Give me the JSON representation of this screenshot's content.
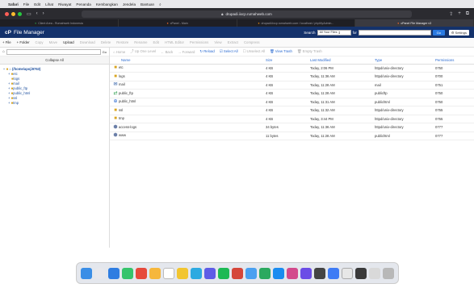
{
  "menubar": {
    "app": "Safari",
    "items": [
      "File",
      "Edit",
      "Lihat",
      "Riwayat",
      "Penanda",
      "Kembangkan",
      "Jendela",
      "Bantuan"
    ],
    "clock": "Kam 16 Jun 15.41"
  },
  "browser": {
    "url": "drupadi.iixcp.rumahweb.com",
    "tabs": [
      {
        "label": "Client Area - Rumahweb Indonesia",
        "active": false
      },
      {
        "label": "cPanel - Main",
        "active": false
      },
      {
        "label": "drupadi.iixcp.rumahweb.com / localhost / phpMyAdmin...",
        "active": false
      },
      {
        "label": "cPanel File Manager v3",
        "active": true
      }
    ]
  },
  "header": {
    "title": "File Manager",
    "search_label": "Search",
    "search_scope": "All Your Files",
    "for_label": "for",
    "go": "Go",
    "settings": "Settings"
  },
  "actions": [
    {
      "label": "+ File",
      "enabled": true
    },
    {
      "label": "+ Folder",
      "enabled": true
    },
    {
      "label": "Copy",
      "enabled": false
    },
    {
      "label": "Move",
      "enabled": false
    },
    {
      "label": "Upload",
      "enabled": true
    },
    {
      "label": "Download",
      "enabled": false
    },
    {
      "label": "Delete",
      "enabled": false
    },
    {
      "label": "Restore",
      "enabled": false
    },
    {
      "label": "Rename",
      "enabled": false
    },
    {
      "label": "Edit",
      "enabled": false
    },
    {
      "label": "HTML Editor",
      "enabled": false
    },
    {
      "label": "Permissions",
      "enabled": false
    },
    {
      "label": "View",
      "enabled": false
    },
    {
      "label": "Extract",
      "enabled": false
    },
    {
      "label": "Compress",
      "enabled": false
    }
  ],
  "sidebar": {
    "go": "Go",
    "collapse": "Collapse All",
    "root": "(/home/apoji9763)",
    "tree": [
      "etc",
      "logs",
      "mail",
      "public_ftp",
      "public_html",
      "ssl",
      "tmp"
    ]
  },
  "nav": {
    "home": "Home",
    "up": "Up One Level",
    "back": "Back",
    "forward": "Forward",
    "reload": "Reload",
    "select_all": "Select All",
    "unselect_all": "Unselect All",
    "view_trash": "View Trash",
    "empty_trash": "Empty Trash"
  },
  "columns": [
    "Name",
    "Size",
    "Last Modified",
    "Type",
    "Permissions"
  ],
  "files": [
    {
      "icon": "folder-icon",
      "name": "etc",
      "size": "4 KB",
      "modified": "Today, 2:06 PM",
      "type": "httpd/unix-directory",
      "perm": "0750"
    },
    {
      "icon": "folder-icon",
      "name": "logs",
      "size": "4 KB",
      "modified": "Today, 11:36 AM",
      "type": "httpd/unix-directory",
      "perm": "0700"
    },
    {
      "icon": "mail-icon",
      "name": "mail",
      "size": "4 KB",
      "modified": "Today, 11:28 AM",
      "type": "mail",
      "perm": "0751"
    },
    {
      "icon": "ftp-icon",
      "name": "public_ftp",
      "size": "4 KB",
      "modified": "Today, 11:28 AM",
      "type": "publicftp",
      "perm": "0750"
    },
    {
      "icon": "globe-icon",
      "name": "public_html",
      "size": "4 KB",
      "modified": "Today, 11:31 AM",
      "type": "publichtml",
      "perm": "0750"
    },
    {
      "icon": "folder-icon",
      "name": "ssl",
      "size": "4 KB",
      "modified": "Today, 11:32 AM",
      "type": "httpd/unix-directory",
      "perm": "0755"
    },
    {
      "icon": "folder-icon",
      "name": "tmp",
      "size": "4 KB",
      "modified": "Today, 3:44 PM",
      "type": "httpd/unix-directory",
      "perm": "0755"
    },
    {
      "icon": "link-icon",
      "name": "access-logs",
      "size": "34 bytes",
      "modified": "Today, 11:36 AM",
      "type": "httpd/unix-directory",
      "perm": "0777"
    },
    {
      "icon": "link-icon",
      "name": "www",
      "size": "11 bytes",
      "modified": "Today, 11:28 AM",
      "type": "publichtml",
      "perm": "0777"
    }
  ],
  "colors": {
    "header": "#14326b",
    "link": "#2a6ad0",
    "folder": "#d9a521"
  }
}
